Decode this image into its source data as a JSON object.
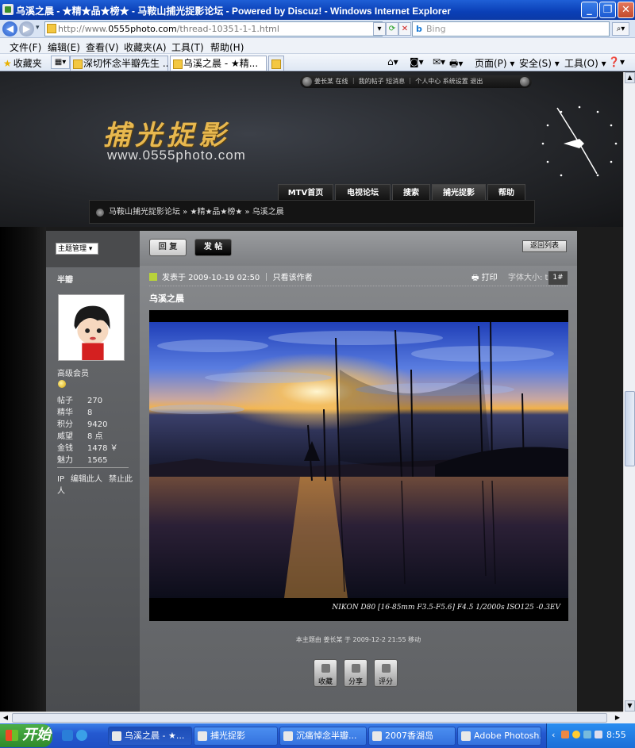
{
  "window": {
    "title": "乌溪之晨 - ★精★品★榜★ - 马鞍山捕光捉影论坛 - Powered by Discuz! - Windows Internet Explorer",
    "min": "_",
    "max": "❐",
    "close": "✕"
  },
  "address": {
    "url_prefix": "http://www.",
    "url_domain": "0555photo.com",
    "url_path": "/thread-10351-1-1.html",
    "search_placeholder": "Bing"
  },
  "menu": [
    "文件(F)",
    "编辑(E)",
    "查看(V)",
    "收藏夹(A)",
    "工具(T)",
    "帮助(H)"
  ],
  "favorites_label": "收藏夹",
  "tabs": [
    {
      "label": "深切怀念半瓣先生 ..."
    },
    {
      "label": "乌溪之晨 - ★精..."
    }
  ],
  "commands": {
    "page": "页面(P) ▾",
    "safety": "安全(S) ▾",
    "tools": "工具(O) ▾",
    "help": "❓▾"
  },
  "site": {
    "user_links": "姜长某 在线 ｜ 我的帖子  短消息  ｜ 个人中心  系统设置 退出",
    "logo_cn": "捕光捉影",
    "logo_en": "www.0555photo.com",
    "nav": [
      "MTV首页",
      "电视论坛",
      "搜索",
      "捕光捉影",
      "帮助"
    ],
    "breadcrumb": "马鞍山捕光捉影论坛  »  ★精★品★榜★  »  乌溪之晨"
  },
  "sidebar": {
    "admin_select": "主题管理 ▾",
    "username": "半瓣",
    "level": "高级会员",
    "stats": [
      {
        "k": "帖子",
        "v": "270"
      },
      {
        "k": "精华",
        "v": "8"
      },
      {
        "k": "积分",
        "v": "9420"
      },
      {
        "k": "威望",
        "v": "8 点"
      },
      {
        "k": "金钱",
        "v": "1478 ￥"
      },
      {
        "k": "魅力",
        "v": "1565"
      }
    ],
    "links": [
      "IP",
      "编辑此人",
      "禁止此人"
    ]
  },
  "post": {
    "reply": "回 复",
    "new_post": "发 帖",
    "back": "返回列表",
    "posted_at": "发表于  2009-10-19 02:50  ｜  只看该作者",
    "print": "🖶 打印",
    "font_size": "字体大小:  t T",
    "floor": "1#",
    "title": "乌溪之晨",
    "caption": "NIKON D80 [16-85mm F3.5-F5.6] F4.5 1/2000s ISO125 -0.3EV",
    "moved_note": "本主题由  姜长某  于  2009-12-2 21:55 移动",
    "actions": [
      "收藏",
      "分享",
      "评分"
    ]
  },
  "taskbar": {
    "start": "开始",
    "buttons": [
      "乌溪之晨 - ★...",
      "捕光捉影",
      "沉痛悼念半瓣...",
      "2007香湖岛",
      "Adobe Photosh..."
    ],
    "time": "8:55"
  }
}
